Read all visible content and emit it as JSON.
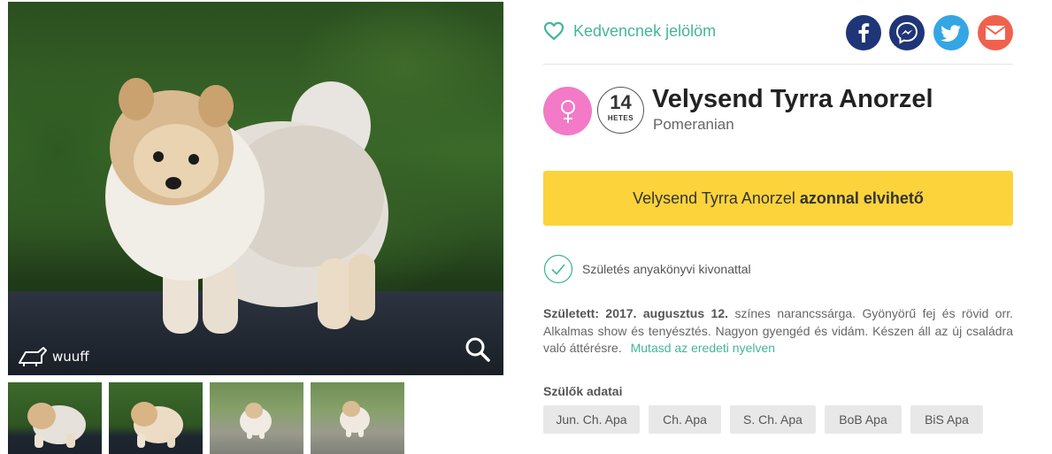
{
  "gallery": {
    "logo_text": "wuuff",
    "main_photo_icon": "dog-photo",
    "zoom_icon": "magnifier-icon",
    "thumbnails": [
      "thumb-1",
      "thumb-2",
      "thumb-3",
      "thumb-4"
    ]
  },
  "favorite": {
    "label": "Kedvencnek jelölöm",
    "icon": "heart-outline-icon",
    "color": "#45b59a"
  },
  "share": {
    "facebook_icon": "facebook-icon",
    "messenger_icon": "messenger-icon",
    "twitter_icon": "twitter-icon",
    "email_icon": "email-icon",
    "colors": {
      "facebook": "#1e3577",
      "messenger": "#1e3577",
      "twitter": "#33a6e3",
      "email": "#f0614d"
    }
  },
  "dog": {
    "gender_icon": "female-symbol-icon",
    "gender_color": "#f27ac6",
    "age_number": "14",
    "age_unit": "HETES",
    "name": "Velysend Tyrra Anorzel",
    "breed": "Pomeranian"
  },
  "cta": {
    "name": "Velysend Tyrra Anorzel",
    "status": "azonnal elvihető",
    "color": "#fcd33b"
  },
  "certificate": {
    "icon": "check-circle-icon",
    "label": "Születés anyakönyvi kivonattal"
  },
  "description": {
    "born_label": "Született: 2017. augusztus 12.",
    "text": "színes narancssárga. Gyönyörű fej és rövid orr. Alkalmas show és tenyésztés. Nagyon gyengéd és vidám. Készen áll az új családra való áttérésre.",
    "link": "Mutasd az eredeti nyelven"
  },
  "parents": {
    "title": "Szülők adatai",
    "chips": [
      "Jun. Ch. Apa",
      "Ch. Apa",
      "S. Ch. Apa",
      "BoB Apa",
      "BiS Apa"
    ]
  }
}
